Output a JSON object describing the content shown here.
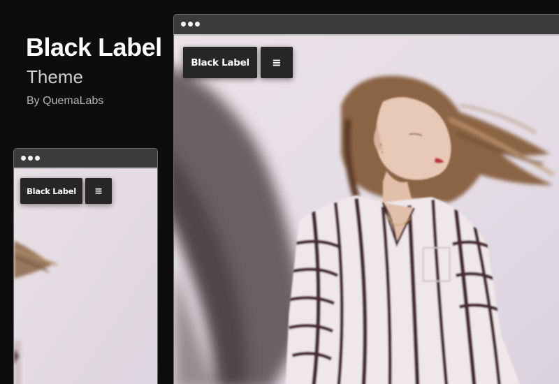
{
  "header": {
    "title": "Black Label",
    "subtitle": "Theme",
    "byline": "By QuemaLabs"
  },
  "preview_small": {
    "brand_label": "Black Label",
    "menu_icon": "hamburger-icon",
    "menu_glyph": "≡"
  },
  "preview_large": {
    "brand_label": "Black Label",
    "menu_icon": "hamburger-icon",
    "menu_glyph": "≡"
  },
  "colors": {
    "page_background": "#0d0d0d",
    "window_chrome": "#3b3b3b",
    "button_background": "#262626",
    "photo_backdrop": "#e6dde4",
    "shirt_stripe": "#4a2a30",
    "lips": "#c0303a"
  }
}
